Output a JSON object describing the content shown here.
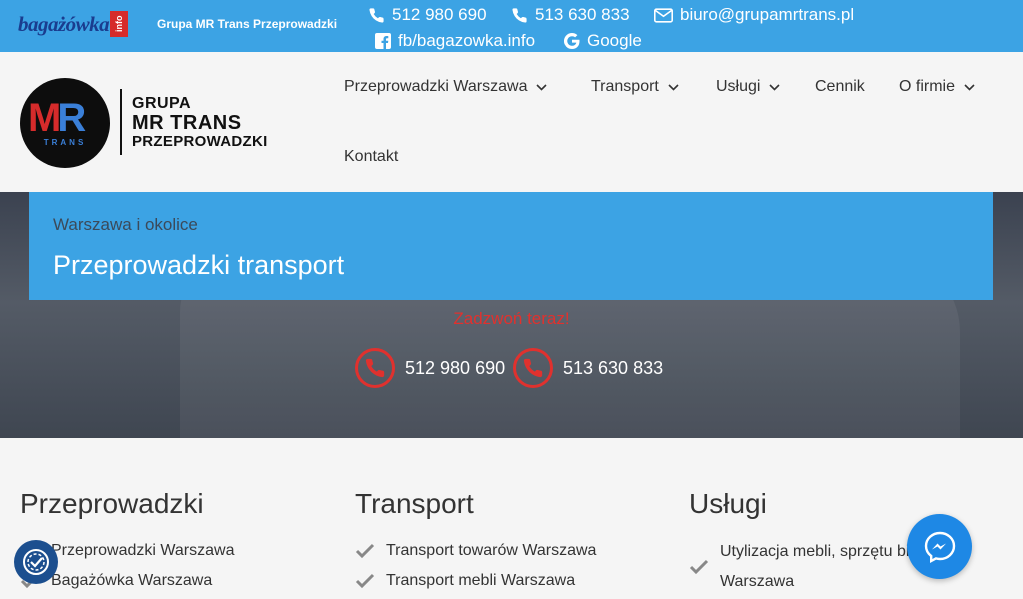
{
  "topbar": {
    "logo_text": "bagażówka",
    "logo_badge": "info",
    "company": "Grupa MR Trans Przeprowadzki",
    "phone1": "512 980 690",
    "phone2": "513 630 833",
    "email": "biuro@grupamrtrans.pl",
    "facebook": "fb/bagazowka.info",
    "google": "Google"
  },
  "logo": {
    "mark_m": "M",
    "mark_r": "R",
    "mark_sub": "TRANS",
    "line1": "GRUPA",
    "line2": "MR TRANS",
    "line3": "PRZEPROWADZKI"
  },
  "nav": {
    "items": [
      {
        "label": "Przeprowadzki Warszawa",
        "dropdown": true
      },
      {
        "label": "Transport",
        "dropdown": true
      },
      {
        "label": "Usługi",
        "dropdown": true
      },
      {
        "label": "Cennik",
        "dropdown": false
      },
      {
        "label": "O firmie",
        "dropdown": true
      },
      {
        "label": "Kontakt",
        "dropdown": false
      }
    ]
  },
  "hero": {
    "subtitle": "Warszawa i okolice",
    "title": "Przeprowadzki transport",
    "call_now": "Zadzwoń teraz!",
    "phone1": "512 980 690",
    "phone2": "513 630 833"
  },
  "columns": [
    {
      "title": "Przeprowadzki",
      "items": [
        "Przeprowadzki Warszawa",
        "Bagażówka Warszawa"
      ]
    },
    {
      "title": "Transport",
      "items": [
        "Transport towarów Warszawa",
        "Transport mebli Warszawa"
      ]
    },
    {
      "title": "Usługi",
      "items": [
        "Utylizacja mebli, sprzętu biur",
        "Warszawa"
      ]
    }
  ],
  "colors": {
    "accent": "#3ca3e4",
    "call_red": "#e0312e",
    "messenger": "#1e88e5"
  }
}
